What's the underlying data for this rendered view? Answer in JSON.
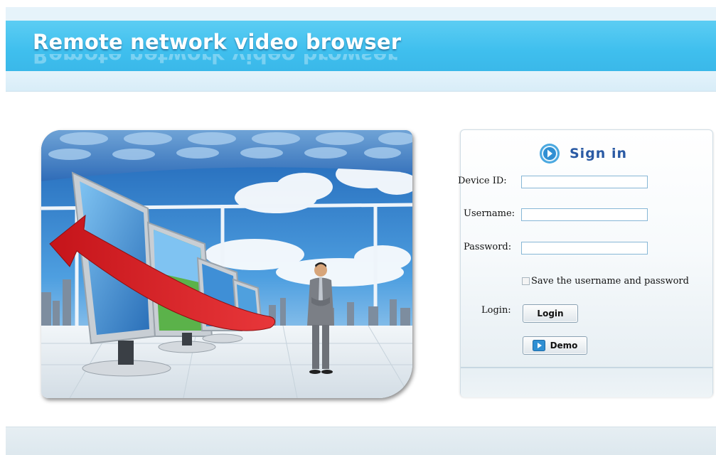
{
  "header": {
    "title": "Remote network video browser"
  },
  "signin": {
    "title": "Sign in",
    "icon": "arrow-circle-icon",
    "fields": {
      "device_id_label": "Device ID:",
      "device_id_value": "",
      "username_label": "Username:",
      "username_value": "",
      "password_label": "Password:",
      "password_value": ""
    },
    "save_label": "Save the username and password",
    "save_checked": false,
    "login_label": "Login:",
    "login_button": "Login",
    "demo_button": "Demo",
    "demo_icon": "play-icon"
  },
  "colors": {
    "banner": "#3fbfee",
    "title_blue": "#2a5aa4",
    "input_border": "#87b7d6"
  }
}
